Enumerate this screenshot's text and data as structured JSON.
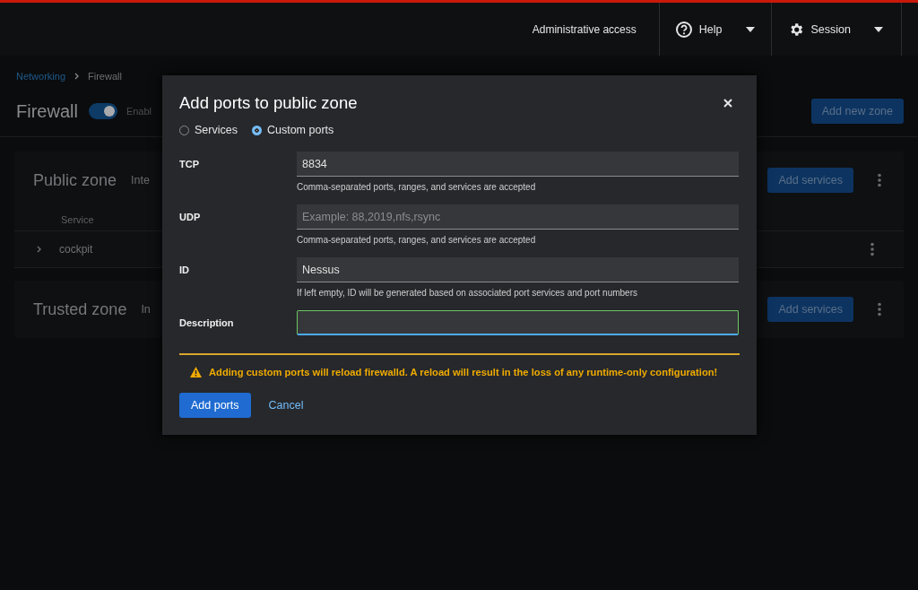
{
  "masthead": {
    "access": "Administrative access",
    "help": "Help",
    "session": "Session"
  },
  "breadcrumb": [
    {
      "label": "Networking",
      "link": true
    },
    {
      "label": "Firewall",
      "link": false
    }
  ],
  "page_header": {
    "title": "Firewall",
    "toggle_on": true,
    "toggle_label": "Enabl",
    "add_zone": "Add new zone"
  },
  "zones": [
    {
      "name": "Public zone",
      "info": "Inte",
      "add_services": "Add services",
      "columns": [
        "Service"
      ],
      "rows": [
        {
          "service": "cockpit",
          "expanded": false
        }
      ]
    },
    {
      "name": "Trusted zone",
      "info": "In",
      "add_services": "Add services"
    }
  ],
  "dialog": {
    "title": "Add ports to public zone",
    "radios": [
      {
        "label": "Services",
        "selected": false
      },
      {
        "label": "Custom ports",
        "selected": true
      }
    ],
    "fields": [
      {
        "label": "TCP",
        "value": "8834",
        "helper": "Comma-separated ports, ranges, and services are accepted",
        "focused": false
      },
      {
        "label": "UDP",
        "placeholder": "Example: 88,2019,nfs,rsync",
        "helper": "Comma-separated ports, ranges, and services are accepted",
        "focused": false
      },
      {
        "label": "ID",
        "value": "Nessus",
        "helper": "If left empty, ID will be generated based on associated port services and port numbers",
        "focused": false
      },
      {
        "label": "Description",
        "focused": true
      }
    ],
    "warning": "Adding custom ports will reload firewalld. A reload will result in the loss of any runtime-only configuration!",
    "primary": "Add ports",
    "cancel": "Cancel"
  }
}
